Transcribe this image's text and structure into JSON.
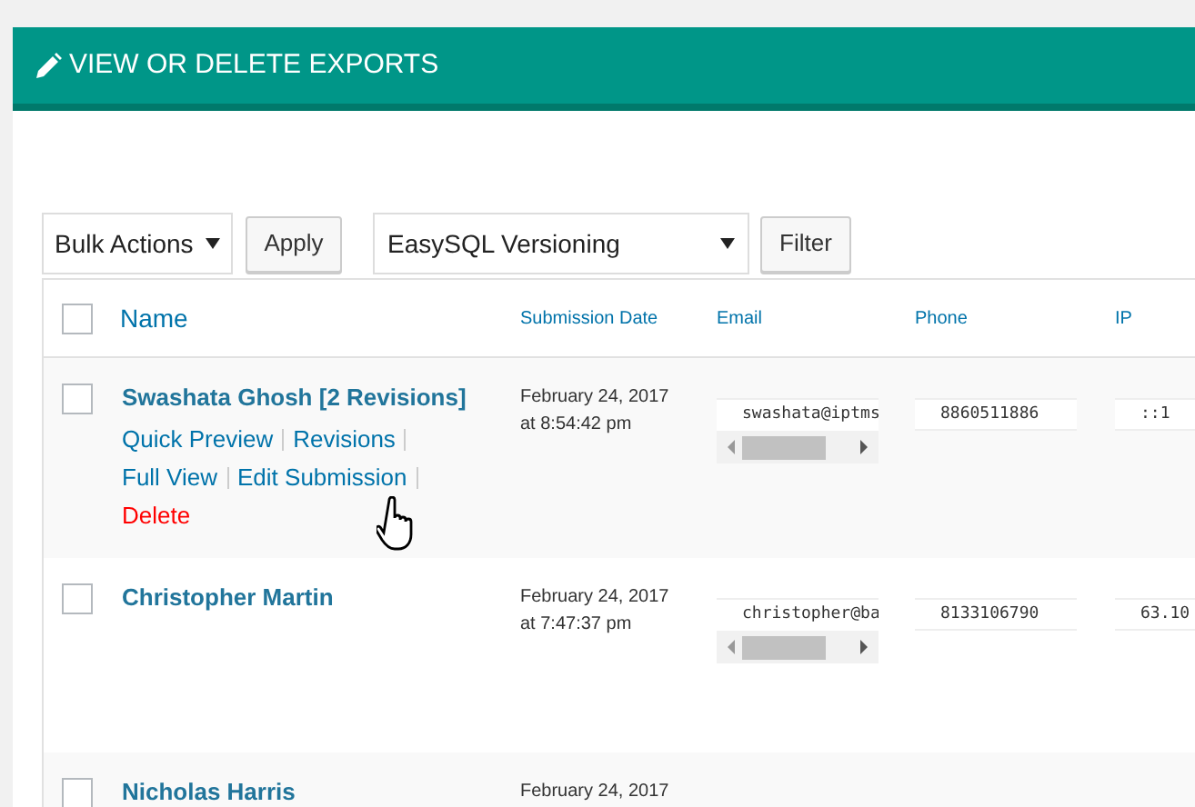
{
  "header": {
    "title": "VIEW OR DELETE EXPORTS"
  },
  "toolbar": {
    "bulk_select": "Bulk Actions",
    "apply_button": "Apply",
    "form_select": "EasySQL Versioning",
    "filter_button": "Filter"
  },
  "table": {
    "header_checkbox": {
      "checked": false
    },
    "columns": [
      "Name",
      "Submission Date",
      "Email",
      "Phone",
      "IP"
    ],
    "rows": [
      {
        "checked": false,
        "name": "Swashata Ghosh [2 Revisions]",
        "date": "February 24, 2017",
        "time": "at 8:54:42 pm",
        "email": "swashata@iptms",
        "phone": "8860511886",
        "ip": "::1",
        "actions": [
          {
            "label": "Quick Preview",
            "kind": "link"
          },
          {
            "label": "Revisions",
            "kind": "link"
          },
          {
            "label": "Full View",
            "kind": "link"
          },
          {
            "label": "Edit Submission",
            "kind": "link"
          },
          {
            "label": "Delete",
            "kind": "delete"
          }
        ]
      },
      {
        "checked": false,
        "name": "Christopher Martin",
        "date": "February 24, 2017",
        "time": "at 7:47:37 pm",
        "email": "christopher@ba",
        "phone": "8133106790",
        "ip": "63.10",
        "actions": []
      },
      {
        "checked": false,
        "name": "Nicholas Harris",
        "date": "February 24, 2017",
        "actions": []
      }
    ]
  }
}
